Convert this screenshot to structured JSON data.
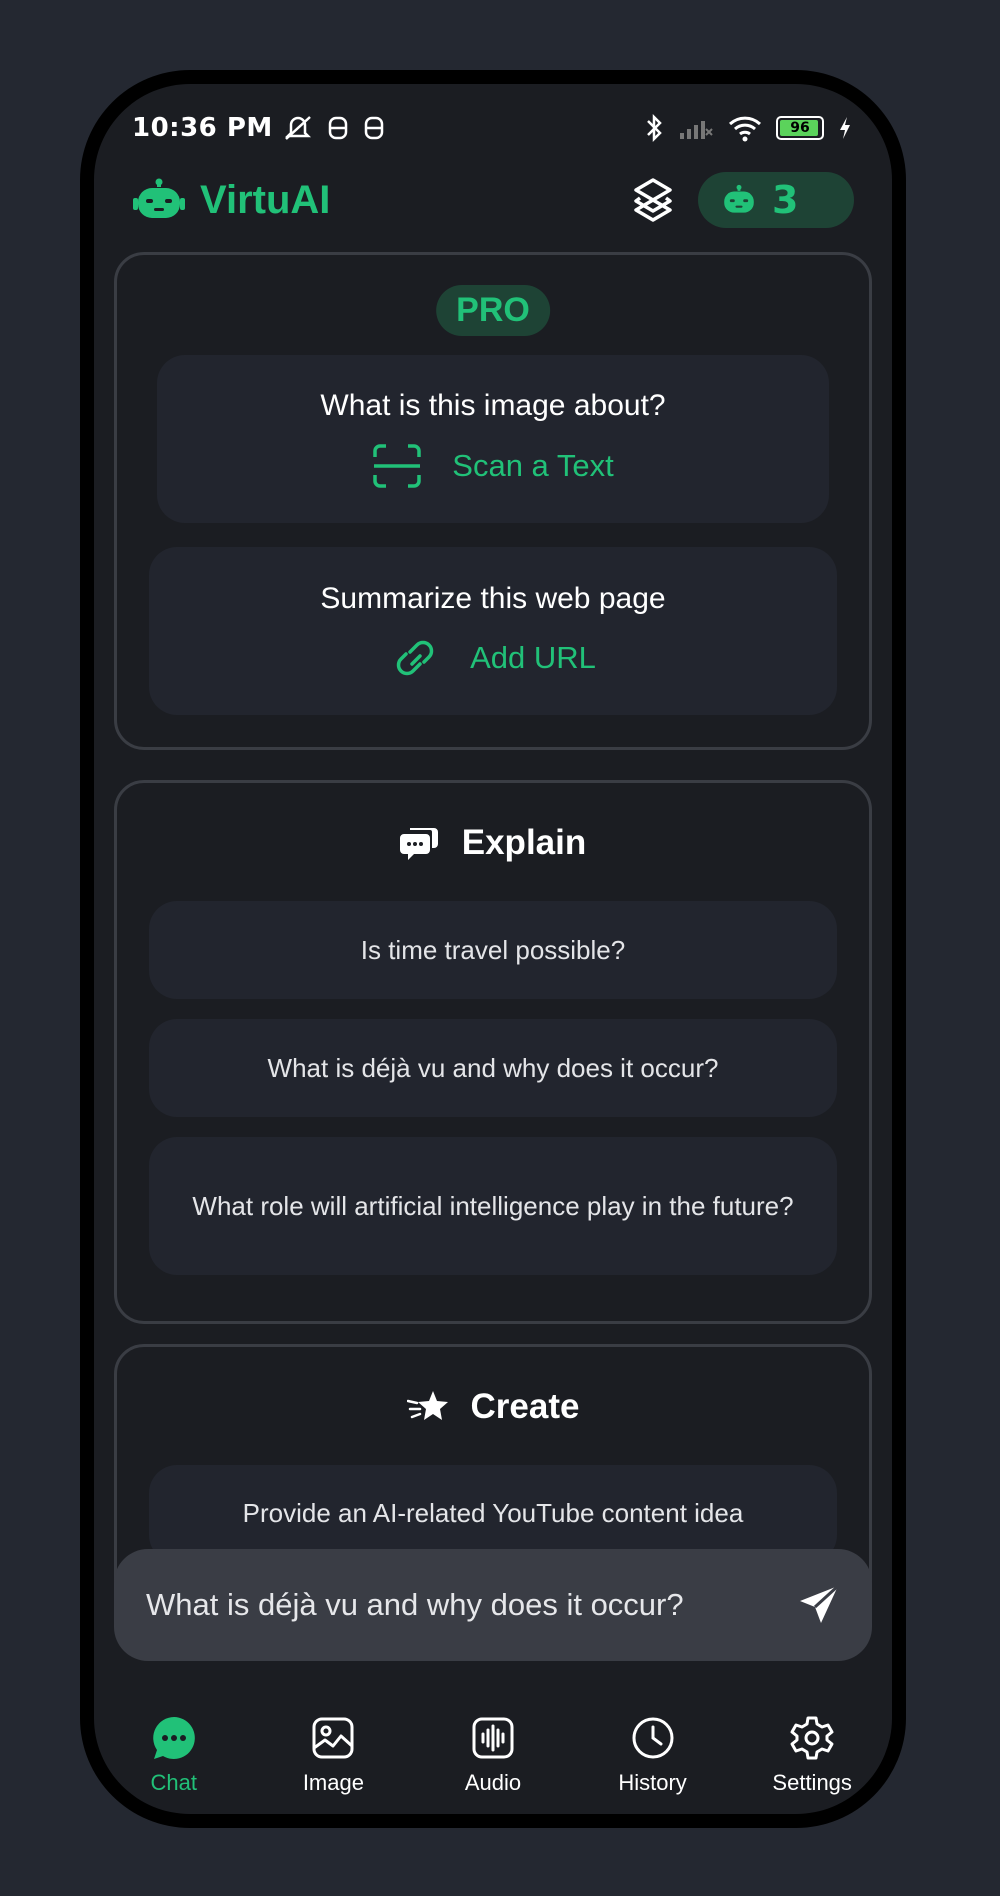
{
  "status_bar": {
    "time": "10:36 PM",
    "battery": "96",
    "battery_level": 0.96
  },
  "header": {
    "app_name": "VirtuAI",
    "credits": "3"
  },
  "pro_section": {
    "badge": "PRO",
    "tiles": [
      {
        "question": "What is this image about?",
        "action": "Scan a Text",
        "icon": "scan-icon"
      },
      {
        "question": "Summarize this web page",
        "action": "Add URL",
        "icon": "link-icon"
      }
    ]
  },
  "explain_section": {
    "title": "Explain",
    "icon": "chat-bubbles-icon",
    "prompts": [
      "Is time travel possible?",
      "What is déjà vu and why does it occur?",
      "What role will artificial intelligence play in the future?"
    ]
  },
  "create_section": {
    "title": "Create",
    "icon": "star-icon",
    "prompts": [
      "Provide an AI-related YouTube content idea"
    ]
  },
  "input": {
    "value": "What is déjà vu and why does it occur?"
  },
  "nav": {
    "items": [
      {
        "label": "Chat",
        "icon": "chat-icon",
        "active": true
      },
      {
        "label": "Image",
        "icon": "image-icon",
        "active": false
      },
      {
        "label": "Audio",
        "icon": "audio-icon",
        "active": false
      },
      {
        "label": "History",
        "icon": "clock-icon",
        "active": false
      },
      {
        "label": "Settings",
        "icon": "gear-icon",
        "active": false
      }
    ]
  },
  "colors": {
    "accent": "#21c178",
    "background": "#1b1d22",
    "tile": "#22252e"
  }
}
